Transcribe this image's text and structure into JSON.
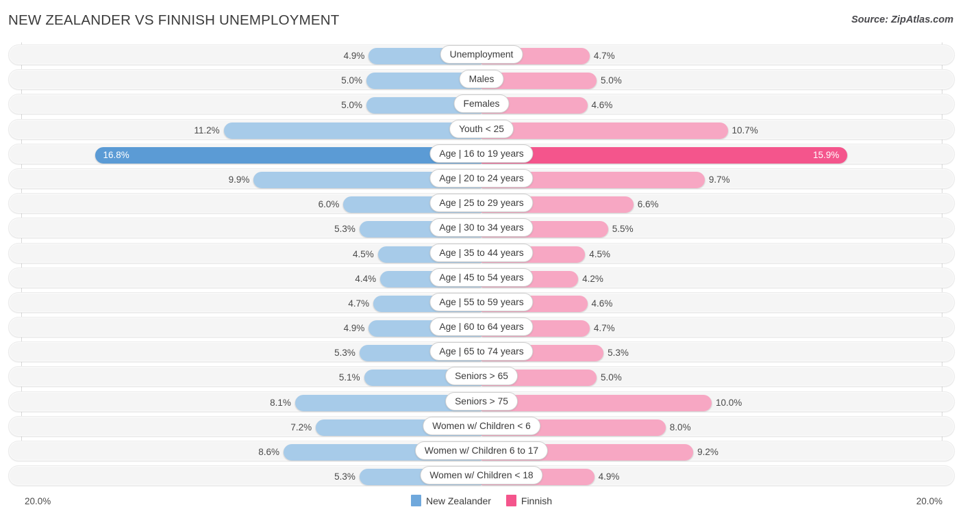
{
  "header": {
    "title": "NEW ZEALANDER VS FINNISH UNEMPLOYMENT",
    "source": "Source: ZipAtlas.com"
  },
  "legend": {
    "items": [
      {
        "label": "New Zealander",
        "color": "#6fa8dc"
      },
      {
        "label": "Finnish",
        "color": "#f4558c"
      }
    ]
  },
  "axis": {
    "left_label": "20.0%",
    "right_label": "20.0%",
    "max": 20.0
  },
  "chart_data": {
    "type": "bar",
    "title": "NEW ZEALANDER VS FINNISH UNEMPLOYMENT",
    "subtitle": "",
    "orientation": "horizontal-diverging",
    "xlabel": "",
    "ylabel": "",
    "xlim": [
      20.0,
      20.0
    ],
    "grid": true,
    "legend_position": "bottom-center",
    "categories": [
      "Unemployment",
      "Males",
      "Females",
      "Youth < 25",
      "Age | 16 to 19 years",
      "Age | 20 to 24 years",
      "Age | 25 to 29 years",
      "Age | 30 to 34 years",
      "Age | 35 to 44 years",
      "Age | 45 to 54 years",
      "Age | 55 to 59 years",
      "Age | 60 to 64 years",
      "Age | 65 to 74 years",
      "Seniors > 65",
      "Seniors > 75",
      "Women w/ Children < 6",
      "Women w/ Children 6 to 17",
      "Women w/ Children < 18"
    ],
    "series": [
      {
        "name": "New Zealander",
        "color": "#6fa8dc",
        "values": [
          4.9,
          5.0,
          5.0,
          11.2,
          16.8,
          9.9,
          6.0,
          5.3,
          4.5,
          4.4,
          4.7,
          4.9,
          5.3,
          5.1,
          8.1,
          7.2,
          8.6,
          5.3
        ],
        "labels": [
          "4.9%",
          "5.0%",
          "5.0%",
          "11.2%",
          "16.8%",
          "9.9%",
          "6.0%",
          "5.3%",
          "4.5%",
          "4.4%",
          "4.7%",
          "4.9%",
          "5.3%",
          "5.1%",
          "8.1%",
          "7.2%",
          "8.6%",
          "5.3%"
        ]
      },
      {
        "name": "Finnish",
        "color": "#f4558c",
        "values": [
          4.7,
          5.0,
          4.6,
          10.7,
          15.9,
          9.7,
          6.6,
          5.5,
          4.5,
          4.2,
          4.6,
          4.7,
          5.3,
          5.0,
          10.0,
          8.0,
          9.2,
          4.9
        ],
        "labels": [
          "4.7%",
          "5.0%",
          "4.6%",
          "10.7%",
          "15.9%",
          "9.7%",
          "6.6%",
          "5.5%",
          "4.5%",
          "4.2%",
          "4.6%",
          "4.7%",
          "5.3%",
          "5.0%",
          "10.0%",
          "8.0%",
          "9.2%",
          "4.9%"
        ]
      }
    ],
    "highlighted_row_index": 4
  },
  "rows": [
    {
      "label": "Unemployment",
      "left": "4.9%",
      "right": "4.7%",
      "lv": 4.9,
      "rv": 4.7,
      "hl": false
    },
    {
      "label": "Males",
      "left": "5.0%",
      "right": "5.0%",
      "lv": 5.0,
      "rv": 5.0,
      "hl": false
    },
    {
      "label": "Females",
      "left": "5.0%",
      "right": "4.6%",
      "lv": 5.0,
      "rv": 4.6,
      "hl": false
    },
    {
      "label": "Youth < 25",
      "left": "11.2%",
      "right": "10.7%",
      "lv": 11.2,
      "rv": 10.7,
      "hl": false
    },
    {
      "label": "Age | 16 to 19 years",
      "left": "16.8%",
      "right": "15.9%",
      "lv": 16.8,
      "rv": 15.9,
      "hl": true
    },
    {
      "label": "Age | 20 to 24 years",
      "left": "9.9%",
      "right": "9.7%",
      "lv": 9.9,
      "rv": 9.7,
      "hl": false
    },
    {
      "label": "Age | 25 to 29 years",
      "left": "6.0%",
      "right": "6.6%",
      "lv": 6.0,
      "rv": 6.6,
      "hl": false
    },
    {
      "label": "Age | 30 to 34 years",
      "left": "5.3%",
      "right": "5.5%",
      "lv": 5.3,
      "rv": 5.5,
      "hl": false
    },
    {
      "label": "Age | 35 to 44 years",
      "left": "4.5%",
      "right": "4.5%",
      "lv": 4.5,
      "rv": 4.5,
      "hl": false
    },
    {
      "label": "Age | 45 to 54 years",
      "left": "4.4%",
      "right": "4.2%",
      "lv": 4.4,
      "rv": 4.2,
      "hl": false
    },
    {
      "label": "Age | 55 to 59 years",
      "left": "4.7%",
      "right": "4.6%",
      "lv": 4.7,
      "rv": 4.6,
      "hl": false
    },
    {
      "label": "Age | 60 to 64 years",
      "left": "4.9%",
      "right": "4.7%",
      "lv": 4.9,
      "rv": 4.7,
      "hl": false
    },
    {
      "label": "Age | 65 to 74 years",
      "left": "5.3%",
      "right": "5.3%",
      "lv": 5.3,
      "rv": 5.3,
      "hl": false
    },
    {
      "label": "Seniors > 65",
      "left": "5.1%",
      "right": "5.0%",
      "lv": 5.1,
      "rv": 5.0,
      "hl": false
    },
    {
      "label": "Seniors > 75",
      "left": "8.1%",
      "right": "10.0%",
      "lv": 8.1,
      "rv": 10.0,
      "hl": false
    },
    {
      "label": "Women w/ Children < 6",
      "left": "7.2%",
      "right": "8.0%",
      "lv": 7.2,
      "rv": 8.0,
      "hl": false
    },
    {
      "label": "Women w/ Children 6 to 17",
      "left": "8.6%",
      "right": "9.2%",
      "lv": 8.6,
      "rv": 9.2,
      "hl": false
    },
    {
      "label": "Women w/ Children < 18",
      "left": "5.3%",
      "right": "4.9%",
      "lv": 5.3,
      "rv": 4.9,
      "hl": false
    }
  ]
}
